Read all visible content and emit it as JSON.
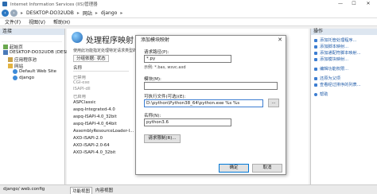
{
  "window": {
    "title": "Internet Information Services (IIS)管理器",
    "controls": [
      "—",
      "☐",
      "✕"
    ]
  },
  "address": {
    "crumbs": [
      "DESKTOP-DO32UDB",
      "网站",
      "django"
    ]
  },
  "menu": [
    "文件(F)",
    "视图(V)",
    "帮助(H)"
  ],
  "left_panel": {
    "header": "连接",
    "tree": [
      {
        "label": "起始页"
      },
      {
        "label": "DESKTOP-DO32UDB (DESKTOP-DO32UDB\\ad"
      },
      {
        "label": "应用程序池"
      },
      {
        "label": "网站"
      },
      {
        "label": "Default Web Site"
      },
      {
        "label": "django"
      }
    ]
  },
  "center": {
    "title": "处理程序映射",
    "description": "使用此功能指定处理特定请求类型的响应的资源，如 DLL 和托管代码。",
    "group_by": "分组依据: 状态",
    "column_header": "名称",
    "items": [
      "已禁用",
      "CGI-exe",
      "ISAPI-dll",
      "已启用",
      "ASPClassic",
      "aspq-Integrated-4.0",
      "aspq-ISAPI-4.0_32bit",
      "aspq-ISAPI-4.0_64bit",
      "AssemblyResourceLoader-I...",
      "AXD-ISAPI-2.0",
      "AXD-ISAPI-2.0-64",
      "AXD-ISAPI-4.0_32bit"
    ]
  },
  "right_panel": {
    "header": "操作",
    "actions": [
      "添加托管处理程序...",
      "添加脚本映射...",
      "添加通配符脚本映射...",
      "添加模块映射...",
      "编辑功能权限...",
      "还原为父项",
      "查看经过排序的列表...",
      "帮助"
    ]
  },
  "dialog": {
    "title": "添加模块映射",
    "request_path_label": "请求路径(P):",
    "request_path_value": "*.py",
    "example": "示例: *.bas, wsvc.axd",
    "module_label": "模块(M):",
    "executable_label": "可执行文件(可选)(E):",
    "executable_value": "D:\\python\\Python38_64\\python.exe %s %s",
    "name_label": "名称(N):",
    "name_value": "python3.6",
    "restrictions_button": "请求限制(R)...",
    "ok_button": "确定",
    "cancel_button": "取消",
    "browse_button": "..."
  },
  "status": {
    "tabs": [
      "功能视图",
      "内容视图"
    ],
    "path": "django/ web.config"
  },
  "colors": {
    "accent": "#0078d7",
    "link": "#1e5aa8",
    "panel_header": "#dde6f0"
  }
}
